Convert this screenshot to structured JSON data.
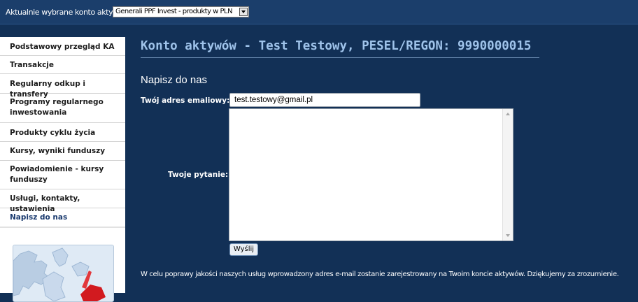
{
  "header": {
    "account_label": "Aktualnie wybrane konto aktywów:",
    "account_selected": "Generali PPF Invest - produkty w PLN"
  },
  "sidebar": {
    "items": [
      {
        "lines": [
          "Podstawowy przegląd KA"
        ]
      },
      {
        "lines": [
          "Transakcje"
        ]
      },
      {
        "lines": [
          "Regularny odkup i transfery"
        ]
      },
      {
        "lines": [
          "Programy regularnego",
          "inwestowania"
        ]
      },
      {
        "lines": [
          "Produkty cyklu życia"
        ]
      },
      {
        "lines": [
          "Kursy, wyniki funduszy"
        ]
      },
      {
        "lines": [
          "Powiadomienie - kursy",
          "funduszy"
        ]
      },
      {
        "lines": [
          "Usługi, kontakty, ustawienia"
        ]
      },
      {
        "lines": [
          "Napisz do nas"
        ],
        "active": true
      }
    ]
  },
  "main": {
    "title": "Konto aktywów - Test Testowy, PESEL/REGON: 9990000015",
    "section_heading": "Napisz do nas",
    "email_label": "Twój adres emaliowy:",
    "email_value": "test.testowy@gmail.pl",
    "question_label": "Twoje pytanie:",
    "question_value": "",
    "send_label": "Wyślij",
    "footer_note": "W celu poprawy jakości naszych usług wprowadzony adres e-mail zostanie zarejestrowany na Twoim koncie aktywów. Dziękujemy za zrozumienie."
  },
  "colors": {
    "background": "#123056",
    "topbar": "#1b3e6b",
    "title": "#9fc3ea",
    "sidebar_bg": "#ffffff",
    "map_accent": "#d0151b"
  }
}
